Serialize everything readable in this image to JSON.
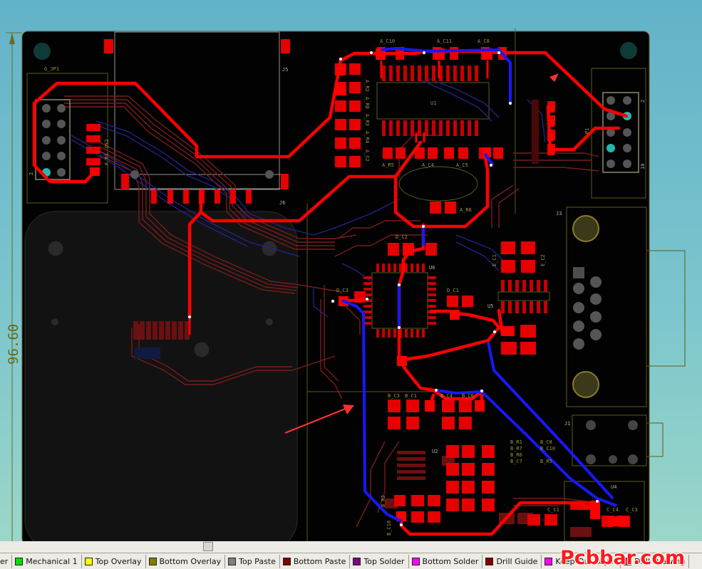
{
  "dimension": {
    "value": "96.60"
  },
  "components": {
    "g_jp1": "G_JP1",
    "j5": "J5",
    "j6": "J6",
    "a_c10": "A_C10",
    "a_c11": "A_C11",
    "a_c8": "A_C8",
    "a_r2": "A_R2",
    "a_r8": "A_R8",
    "a_r3": "A_R3",
    "a_r4": "A_R4",
    "a_c2": "A_C2",
    "a_r5": "A_R5",
    "a_c4": "A_C4",
    "a_c5": "A_C5",
    "a_r6": "A_R6",
    "u1": "U1",
    "p1": "P1",
    "j3": "J3",
    "d_c2": "D_C2",
    "u6": "U6",
    "d_c3": "D_C3",
    "d_c1": "D_C1",
    "u5": "U5",
    "e_c1": "E_C1",
    "e_c2": "E_C2",
    "b_c3": "B_C3",
    "b_c1": "B_C1",
    "b_c4": "B_C4",
    "b_c6": "B_C6",
    "u2": "U2",
    "b_r1": "B_R1",
    "b_r2": "B_R2",
    "b_r7": "B_R7",
    "b_r6": "B_R6",
    "b_c7": "B_C7",
    "b_c8": "B_C8",
    "b_c10": "B_C10",
    "b_r5": "B_R5",
    "b_c18": "B_C18",
    "j1": "J1",
    "u4": "U4",
    "c_c1": "C_C1",
    "c_c4": "C_C4",
    "c_c3": "C_C3",
    "f_r1": "F_R1",
    "ds2": "DS2",
    "pin2": "2",
    "pin10": "10",
    "pin_left2": "2"
  },
  "layers": [
    {
      "name": "er",
      "color": "#ffffff"
    },
    {
      "name": "Mechanical 1",
      "color": "#00e000"
    },
    {
      "name": "Top Overlay",
      "color": "#ffff00"
    },
    {
      "name": "Bottom Overlay",
      "color": "#808000"
    },
    {
      "name": "Top Paste",
      "color": "#808080"
    },
    {
      "name": "Bottom Paste",
      "color": "#800000"
    },
    {
      "name": "Top Solder",
      "color": "#800080"
    },
    {
      "name": "Bottom Solder",
      "color": "#ff00ff"
    },
    {
      "name": "Drill Guide",
      "color": "#800000"
    },
    {
      "name": "Keep-Out Layer",
      "color": "#ff00ff"
    },
    {
      "name": "Drill Drawing",
      "color": "#ff002a"
    }
  ],
  "watermark": {
    "text": "Pcbbar.com"
  },
  "colors": {
    "board": "#020202",
    "top_copper": "#ff0000",
    "bottom_copper": "#1818ff",
    "overlay": "#6d6b1c",
    "pad": "#ee0000",
    "bottom_trace": "#7a1c1c",
    "mid_trace": "#242490"
  }
}
